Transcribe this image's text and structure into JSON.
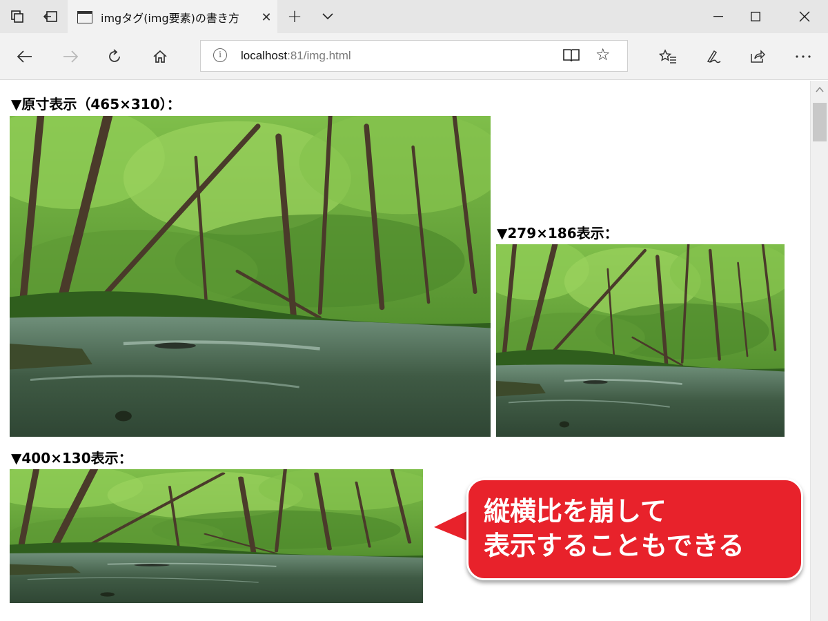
{
  "browser": {
    "tab_title": "imgタグ(img要素)の書き方",
    "url_host": "localhost",
    "url_rest": ":81/img.html"
  },
  "content": {
    "label_original": "▼原寸表示（465×310）：",
    "label_medium": "▼279×186表示：",
    "label_stretched": "▼400×130表示："
  },
  "callout": {
    "line1": "縦横比を崩して",
    "line2": "表示することもできる"
  },
  "colors": {
    "callout_red": "#e8222b",
    "tabbar_bg": "#e6e6e6",
    "navbar_bg": "#f2f2f2"
  },
  "icons": {
    "tabs_aside": "tabs-aside-icon",
    "show_tabs": "show-tabs-icon",
    "back": "back-arrow-icon",
    "forward": "forward-arrow-icon",
    "refresh": "refresh-icon",
    "home": "home-icon",
    "reading_view": "reading-view-icon",
    "favorite": "star-icon",
    "favorites_hub": "favorites-hub-icon",
    "web_note": "pen-icon",
    "share": "share-icon",
    "more": "more-icon"
  }
}
